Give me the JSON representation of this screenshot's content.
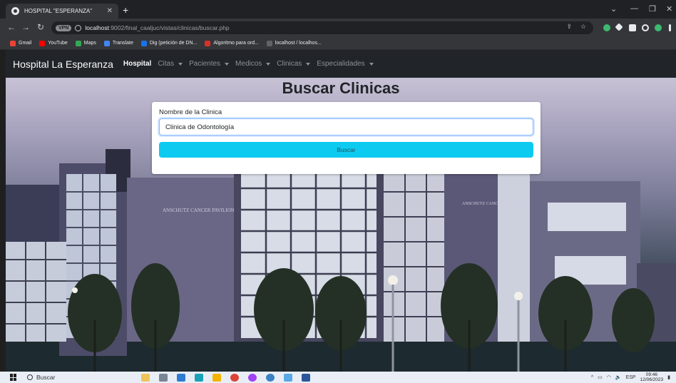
{
  "browser": {
    "tab_title": "HOSPITAL \"ESPERANZA\"",
    "vpn_label": "VPN",
    "url_host": "localhost",
    "url_path": ":9002/final_caaljuc/vistas/clinicas/buscar.php"
  },
  "bookmarks": [
    {
      "label": "Gmail",
      "color": "#ea4335"
    },
    {
      "label": "YouTube",
      "color": "#ff0000"
    },
    {
      "label": "Maps",
      "color": "#34a853"
    },
    {
      "label": "Translate",
      "color": "#4285f4"
    },
    {
      "label": "Dig (petición de DN...",
      "color": "#1a73e8"
    },
    {
      "label": "Algoritmo para ord...",
      "color": "#d93025"
    },
    {
      "label": "localhost / localhos...",
      "color": "#5f6368"
    }
  ],
  "navbar": {
    "brand": "Hospital La Esperanza",
    "items": [
      {
        "label": "Hospital",
        "active": true,
        "dropdown": false
      },
      {
        "label": "Citas",
        "active": false,
        "dropdown": true
      },
      {
        "label": "Pacientes",
        "active": false,
        "dropdown": true
      },
      {
        "label": "Medicos",
        "active": false,
        "dropdown": true
      },
      {
        "label": "Clinicas",
        "active": false,
        "dropdown": true
      },
      {
        "label": "Especialidades",
        "active": false,
        "dropdown": true
      }
    ]
  },
  "page": {
    "title": "Buscar Clinicas",
    "field_label": "Nombre de la Clinica",
    "field_value": "Clinica de Odontología",
    "button_label": "Buscar"
  },
  "building_signs": {
    "left": "ANSCHUTZ CANCER PAVILION",
    "right": "ANSCHUTZ CANCER PAVILION"
  },
  "taskbar": {
    "search_label": "Buscar",
    "language": "ESP",
    "time": "09:46",
    "date": "12/06/2023"
  },
  "colors": {
    "navbar_bg": "#212529",
    "button_bg": "#0dcaf0"
  }
}
